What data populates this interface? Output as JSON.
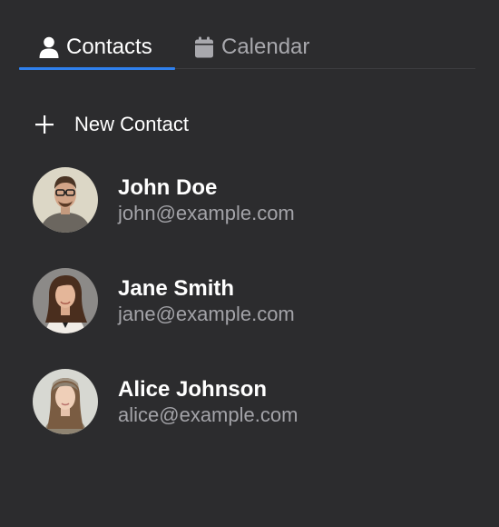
{
  "tabs": [
    {
      "label": "Contacts",
      "icon": "person-icon",
      "active": true
    },
    {
      "label": "Calendar",
      "icon": "calendar-icon",
      "active": false
    }
  ],
  "new_contact": {
    "label": "New Contact",
    "icon": "plus-icon"
  },
  "contacts": [
    {
      "name": "John Doe",
      "email": "john@example.com"
    },
    {
      "name": "Jane Smith",
      "email": "jane@example.com"
    },
    {
      "name": "Alice Johnson",
      "email": "alice@example.com"
    }
  ],
  "colors": {
    "background": "#2c2c2e",
    "accent": "#2f80ed",
    "secondary_text": "#a3a3a8"
  }
}
